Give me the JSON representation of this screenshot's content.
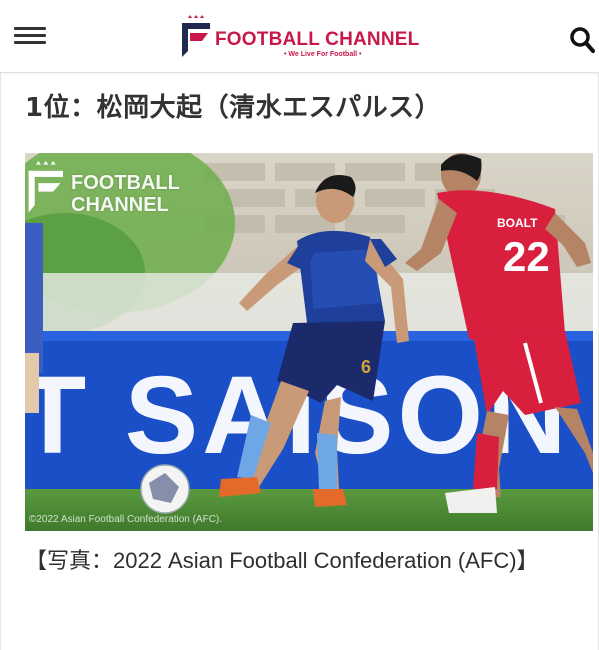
{
  "header": {
    "menu_icon": "hamburger-menu-icon",
    "logo_text": "FOOTBALL CHANNEL",
    "logo_tagline": "• We Live For Football •",
    "search_icon": "search-icon",
    "brand_color": "#c8184a",
    "brand_navy": "#1f2a4e"
  },
  "article": {
    "heading": "1位：松岡大起（清水エスパルス）",
    "photo": {
      "watermark": "FOOTBALL CHANNEL",
      "ad_board_text": "T SAISON",
      "player_number": "6",
      "opponent_number": "22",
      "opponent_name": "BOALT",
      "copyright": "©2022 Asian Football Confederation (AFC)."
    },
    "caption": "【写真：2022 Asian Football Confederation (AFC)】"
  }
}
